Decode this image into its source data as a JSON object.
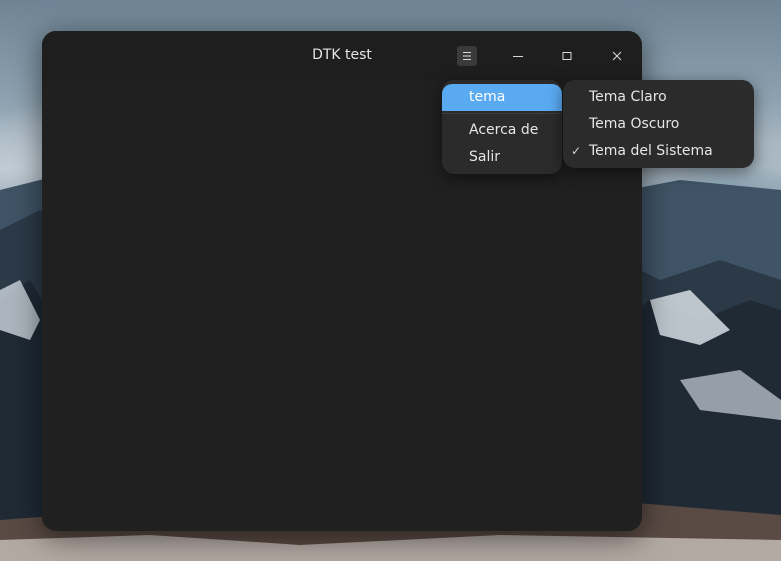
{
  "window": {
    "title": "DTK test"
  },
  "titlebar": {
    "menu_icon": "hamburger-icon",
    "minimize_icon": "minimize-icon",
    "maximize_icon": "maximize-icon",
    "close_icon": "close-icon"
  },
  "main_menu": {
    "items": [
      {
        "label": "tema",
        "highlighted": true,
        "has_submenu": true
      },
      {
        "label": "Acerca de"
      },
      {
        "label": "Salir"
      }
    ]
  },
  "theme_submenu": {
    "items": [
      {
        "label": "Tema Claro",
        "checked": false
      },
      {
        "label": "Tema Oscuro",
        "checked": false
      },
      {
        "label": "Tema del Sistema",
        "checked": true
      }
    ],
    "check_mark": "✓"
  },
  "colors": {
    "accent": "#5aaaf2",
    "window_bg": "#202020",
    "menu_bg": "#2b2b2b"
  }
}
